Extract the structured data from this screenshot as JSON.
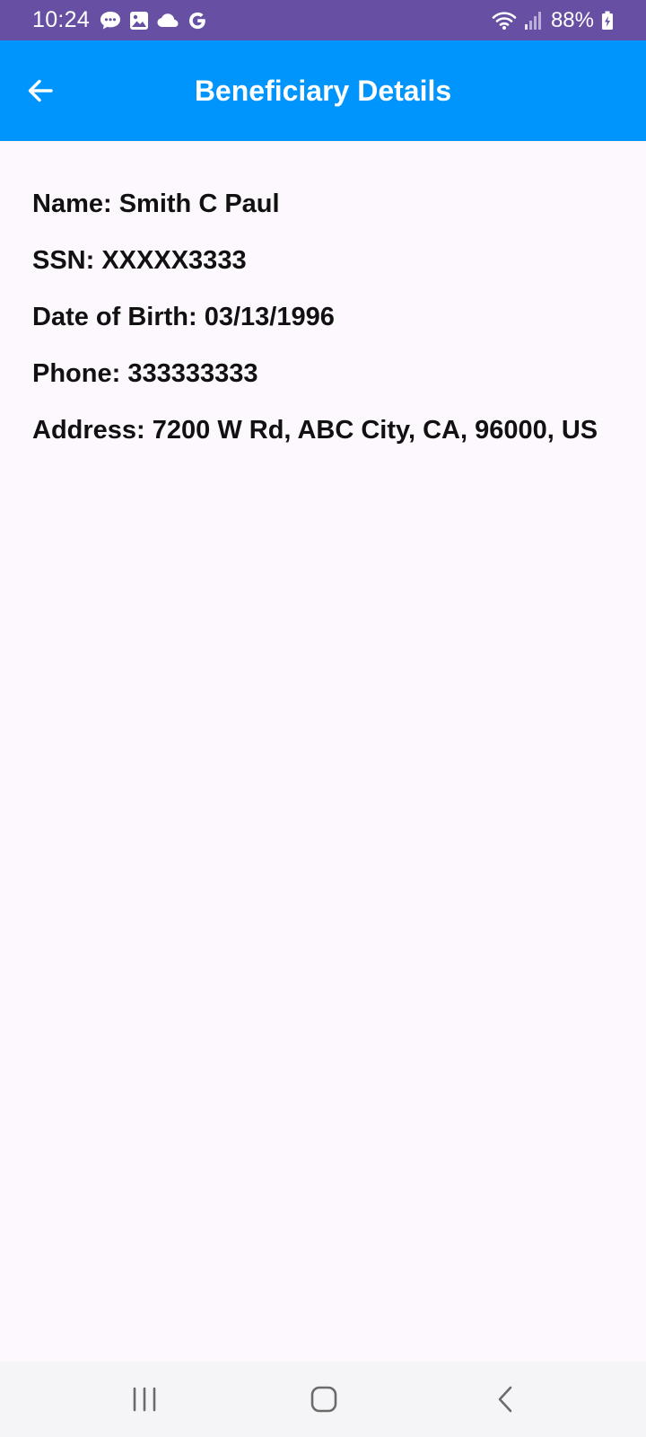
{
  "status_bar": {
    "time": "10:24",
    "battery": "88%",
    "background": "#6750a4",
    "notification_icons": [
      "messages-icon",
      "gallery-icon",
      "cloud-icon",
      "google-icon"
    ],
    "system_icons": [
      "wifi-icon",
      "signal-icon",
      "battery-charging-icon"
    ]
  },
  "app_bar": {
    "title": "Beneficiary Details",
    "back_icon": "arrow-left-icon",
    "background": "#0094fd"
  },
  "details": {
    "name": "Name: Smith C Paul",
    "ssn": "SSN: XXXXX3333",
    "dob": "Date of Birth: 03/13/1996",
    "phone": "Phone: 333333333",
    "address": "Address: 7200 W Rd, ABC City, CA, 96000, US"
  },
  "nav_bar": {
    "recents_icon": "recents-icon",
    "home_icon": "home-icon",
    "back_icon": "back-chevron-icon"
  }
}
